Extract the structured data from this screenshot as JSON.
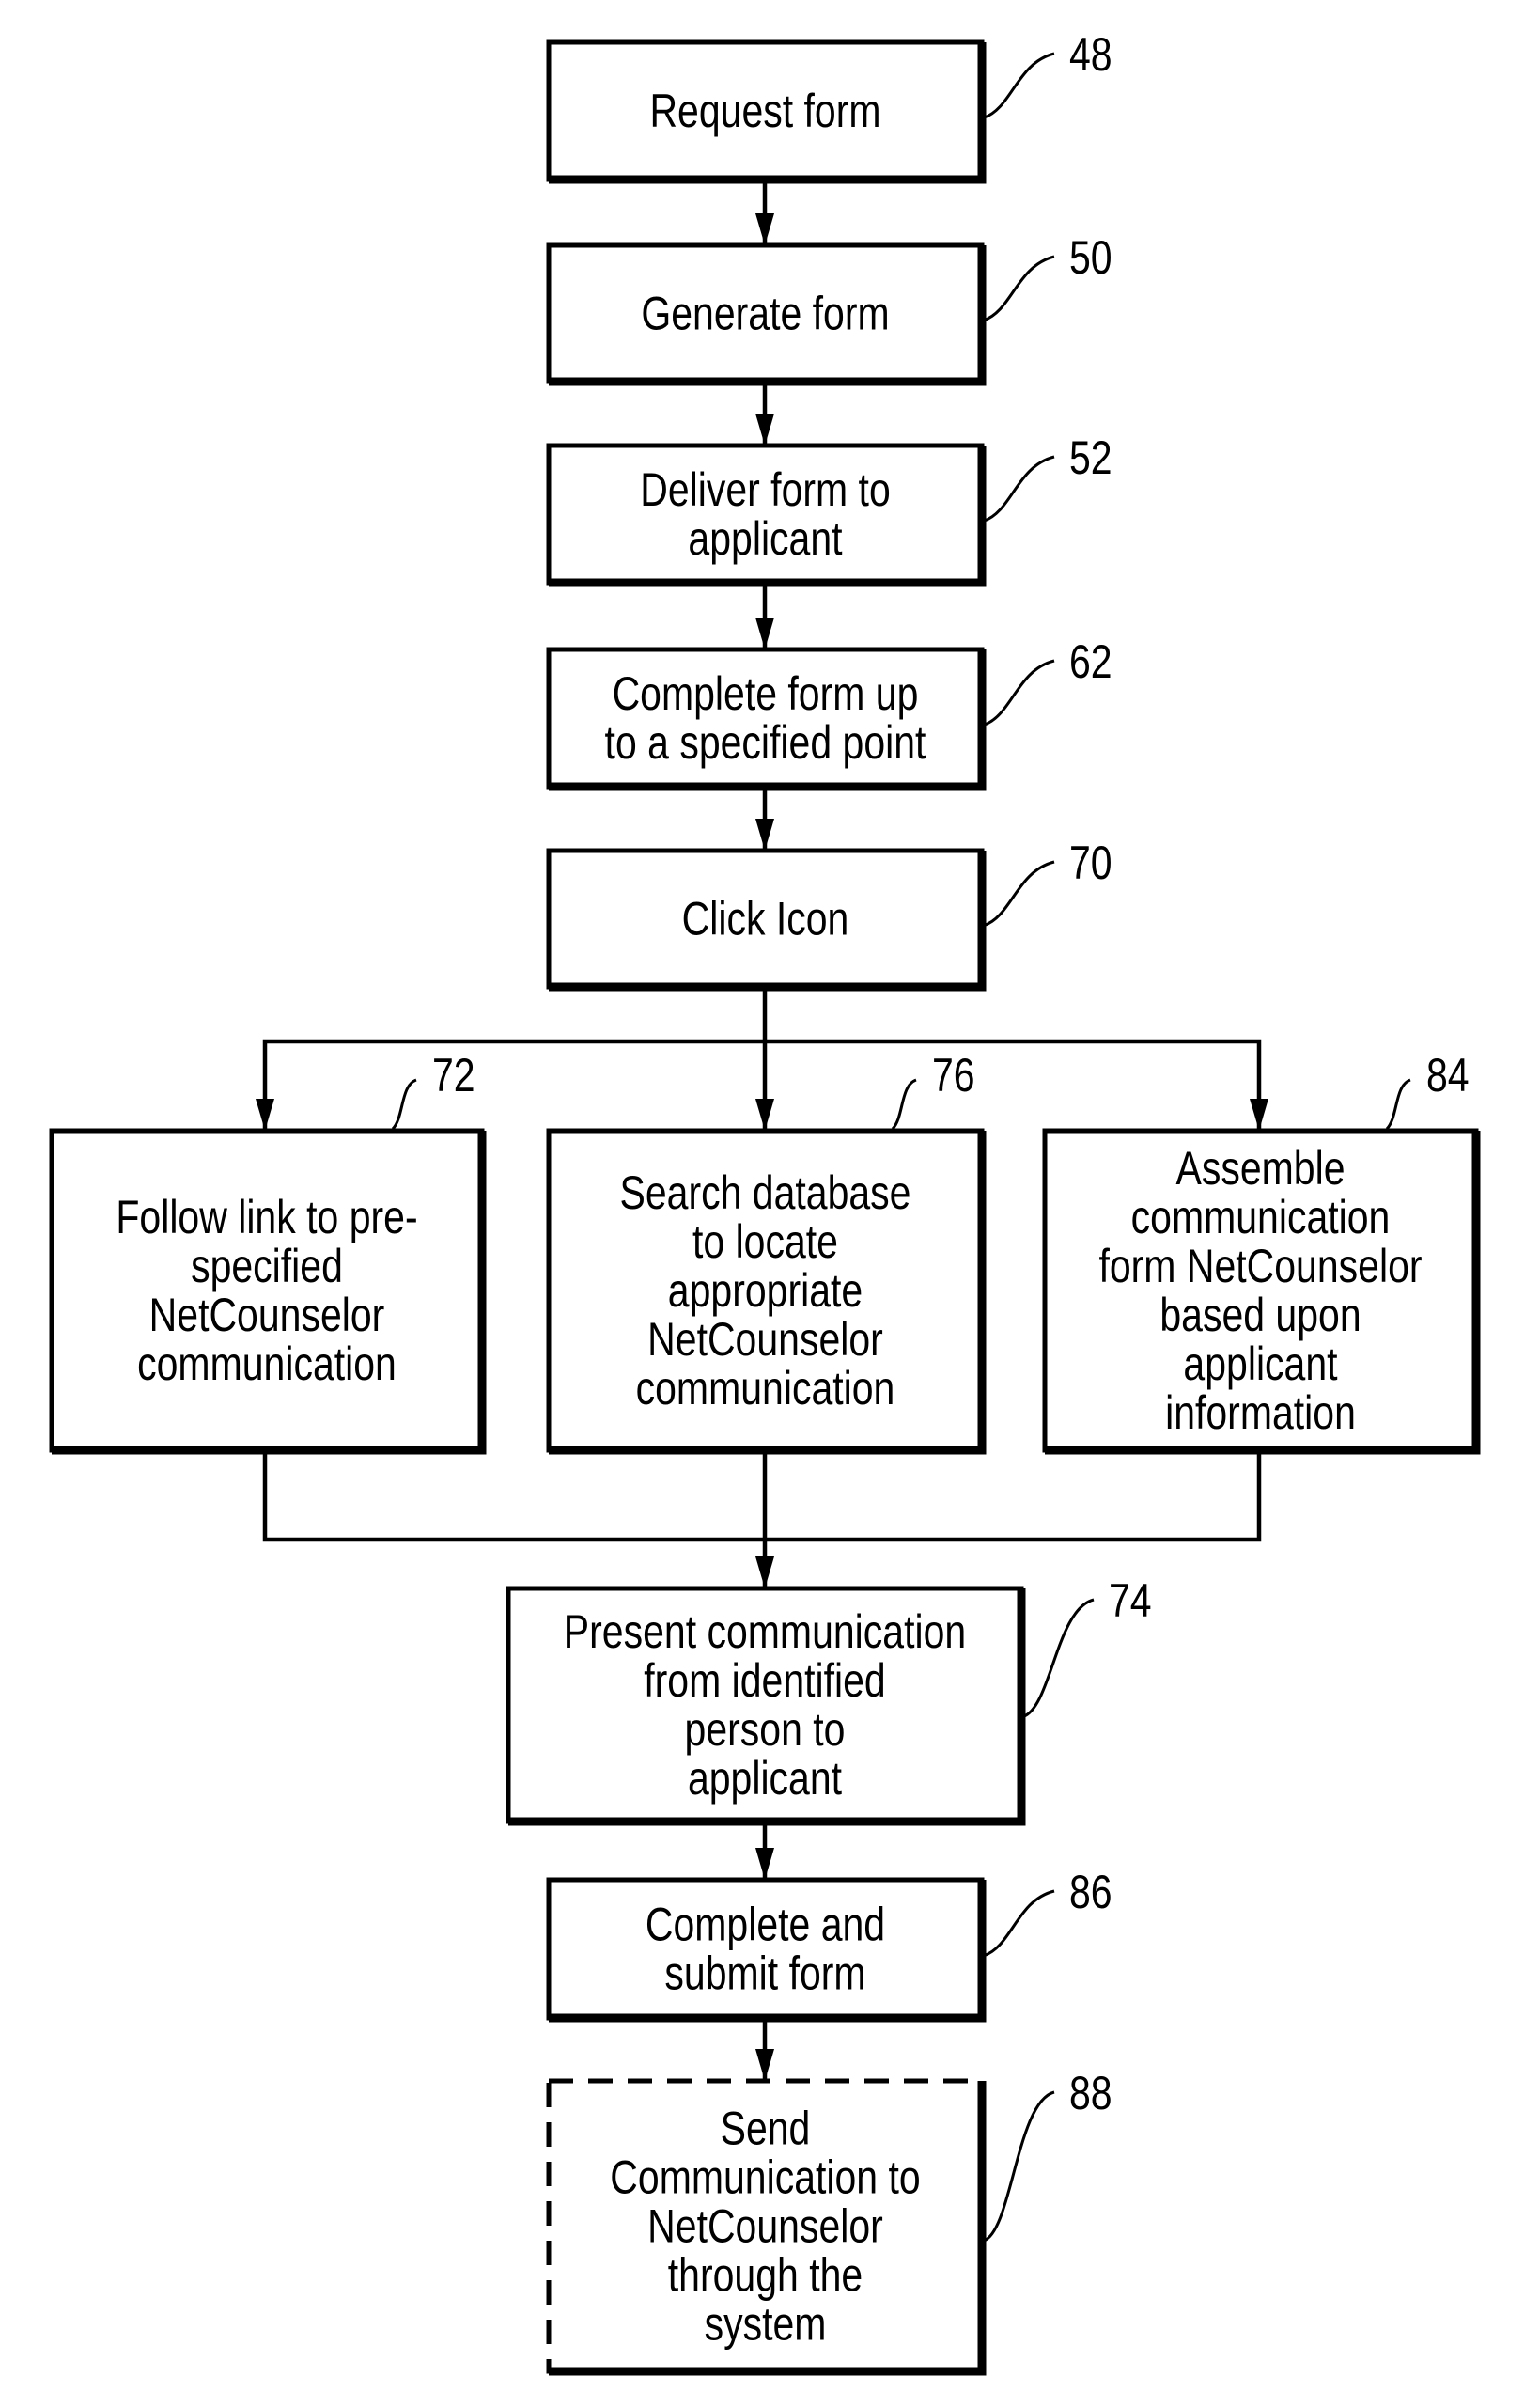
{
  "diagram": {
    "type": "flowchart",
    "steps": [
      {
        "id": "48",
        "ref": "48",
        "lines": [
          "Request form"
        ],
        "style": "solid"
      },
      {
        "id": "50",
        "ref": "50",
        "lines": [
          "Generate form"
        ],
        "style": "solid"
      },
      {
        "id": "52",
        "ref": "52",
        "lines": [
          "Deliver form to",
          "applicant"
        ],
        "style": "solid"
      },
      {
        "id": "62",
        "ref": "62",
        "lines": [
          "Complete form up",
          "to a specified point"
        ],
        "style": "solid"
      },
      {
        "id": "70",
        "ref": "70",
        "lines": [
          "Click Icon"
        ],
        "style": "solid"
      },
      {
        "id": "72",
        "ref": "72",
        "lines": [
          "Follow link to pre-",
          "specified",
          "NetCounselor",
          "communication"
        ],
        "style": "solid"
      },
      {
        "id": "76",
        "ref": "76",
        "lines": [
          "Search database",
          "to locate",
          "appropriate",
          "NetCounselor",
          "communication"
        ],
        "style": "solid"
      },
      {
        "id": "84",
        "ref": "84",
        "lines": [
          "Assemble",
          "communication",
          "form NetCounselor",
          "based upon",
          "applicant",
          "information"
        ],
        "style": "solid"
      },
      {
        "id": "74",
        "ref": "74",
        "lines": [
          "Present communication",
          "from identified",
          "person to",
          "applicant"
        ],
        "style": "solid"
      },
      {
        "id": "86",
        "ref": "86",
        "lines": [
          "Complete and",
          "submit form"
        ],
        "style": "solid"
      },
      {
        "id": "88",
        "ref": "88",
        "lines": [
          "Send",
          "Communication to",
          "NetCounselor",
          "through the",
          "system"
        ],
        "style": "dashed"
      }
    ],
    "edges": [
      {
        "from": "48",
        "to": "50"
      },
      {
        "from": "50",
        "to": "52"
      },
      {
        "from": "52",
        "to": "62"
      },
      {
        "from": "62",
        "to": "70"
      },
      {
        "from": "70",
        "to": "72"
      },
      {
        "from": "70",
        "to": "76"
      },
      {
        "from": "70",
        "to": "84"
      },
      {
        "from": "72",
        "to": "74"
      },
      {
        "from": "76",
        "to": "74"
      },
      {
        "from": "84",
        "to": "74"
      },
      {
        "from": "74",
        "to": "86"
      },
      {
        "from": "86",
        "to": "88"
      }
    ]
  }
}
